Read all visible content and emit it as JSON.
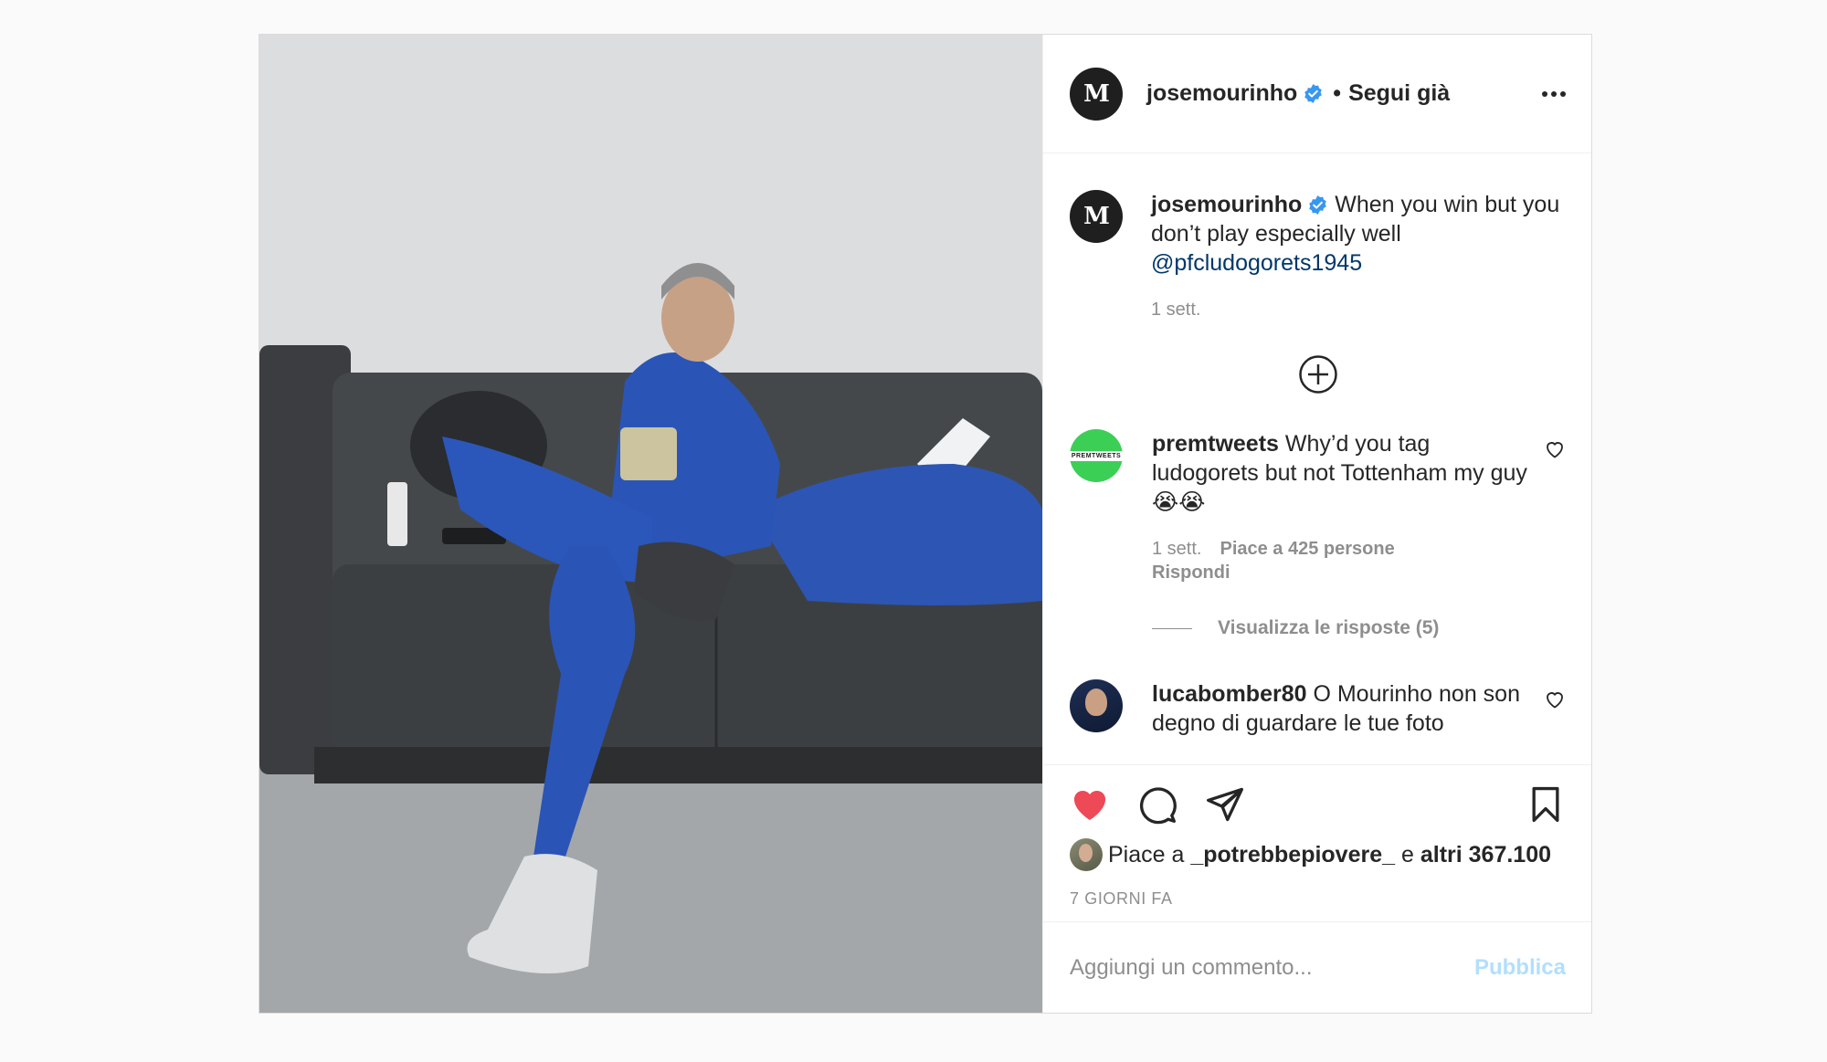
{
  "post": {
    "author": "josemourinho",
    "avatar_text": "M",
    "follow_label": "Segui già",
    "separator": "•",
    "caption": {
      "user": "josemourinho",
      "text": "When you win but you don’t play especially well",
      "mention": "@pfcludogorets1945",
      "time": "1 sett."
    }
  },
  "comments": [
    {
      "user": "premtweets",
      "avatar_text": "PREMTWEETS",
      "text": "Why’d you tag ludogorets but not Tottenham my guy 😭😭",
      "time": "1 sett.",
      "likes": "Piace a 425 persone",
      "reply_label": "Rispondi",
      "view_replies": "Visualizza le risposte (5)"
    },
    {
      "user": "lucabomber80",
      "text": "O Mourinho non son degno di guardare le tue foto"
    }
  ],
  "likes": {
    "prefix": "Piace a",
    "user": "_potrebbepiovere_",
    "middle": "e",
    "others": "altri 367.100"
  },
  "timestamp": "7 GIORNI FA",
  "add_comment": {
    "placeholder": "Aggiungi un commento...",
    "publish_label": "Pubblica"
  },
  "colors": {
    "like_red": "#ed4956",
    "verified_blue": "#3897f0",
    "mention": "#00376b",
    "publish_disabled": "#b2dffc"
  }
}
